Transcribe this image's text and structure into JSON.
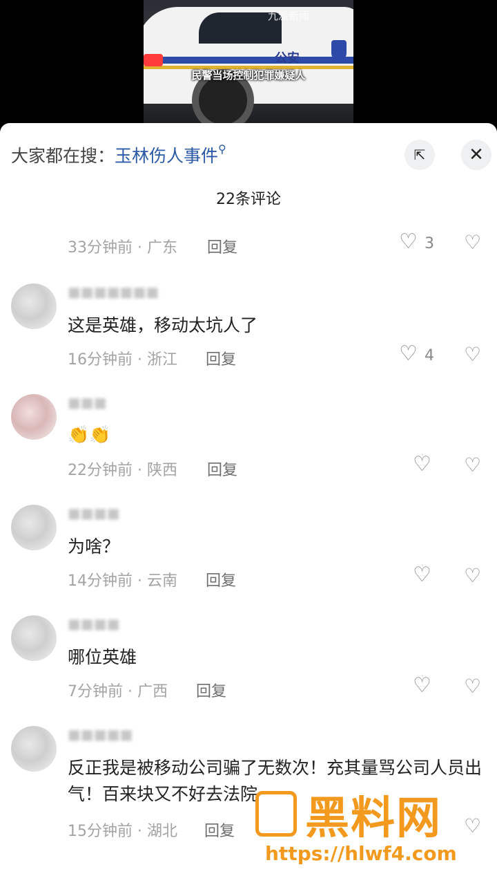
{
  "video": {
    "brand_text": "九派新闻",
    "car_label": "公安",
    "caption": "民警当场控制犯罪嫌疑人"
  },
  "search": {
    "prefix": "大家都在搜：",
    "hot_term": "玉林伤人事件",
    "icon": "search-icon"
  },
  "header": {
    "comment_count": "22条评论",
    "expand_icon": "expand-icon",
    "close_icon": "close-icon"
  },
  "comments": [
    {
      "text": "",
      "time_location": "33分钟前 · 广东",
      "reply": "回复",
      "likes": "3"
    },
    {
      "text": "这是英雄，移动太坑人了",
      "time_location": "16分钟前 · 浙江",
      "reply": "回复",
      "likes": "4"
    },
    {
      "text": "👏👏",
      "time_location": "22分钟前 · 陕西",
      "reply": "回复",
      "likes": ""
    },
    {
      "text": "为啥？",
      "time_location": "14分钟前 · 云南",
      "reply": "回复",
      "likes": ""
    },
    {
      "text": "哪位英雄",
      "time_location": "7分钟前 · 广西",
      "reply": "回复",
      "likes": ""
    },
    {
      "text": "反正我是被移动公司骗了无数次！充其量骂公司人员出气！百来块又不好去法院",
      "time_location": "15分钟前 · 湖北",
      "reply": "回复",
      "likes": ""
    }
  ],
  "watermark": {
    "name": "黑料网",
    "url": "https://hlwf4.com"
  },
  "colors": {
    "link_blue": "#2a5aa8",
    "watermark_orange": "#f39a1e"
  }
}
